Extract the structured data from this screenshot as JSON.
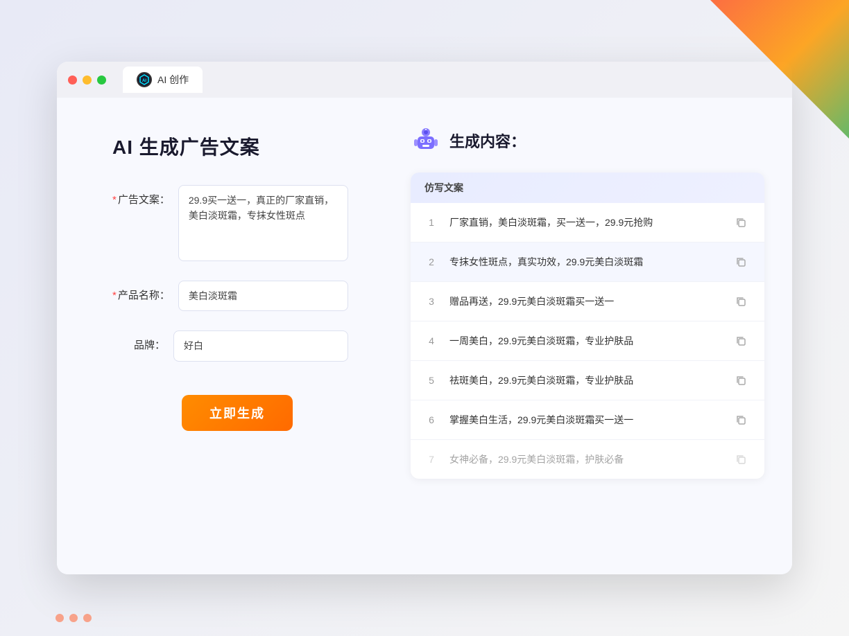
{
  "browser": {
    "tab_icon_label": "AI",
    "tab_title": "AI 创作"
  },
  "left_panel": {
    "page_title": "AI 生成广告文案",
    "form": {
      "ad_copy_label": "广告文案：",
      "ad_copy_required": "*",
      "ad_copy_value": "29.9买一送一，真正的厂家直销，美白淡斑霜，专抹女性斑点",
      "product_name_label": "产品名称：",
      "product_name_required": "*",
      "product_name_value": "美白淡斑霜",
      "brand_label": "品牌：",
      "brand_value": "好白"
    },
    "generate_button_label": "立即生成"
  },
  "right_panel": {
    "title": "生成内容：",
    "table_header": "仿写文案",
    "results": [
      {
        "id": 1,
        "text": "厂家直销，美白淡斑霜，买一送一，29.9元抢购"
      },
      {
        "id": 2,
        "text": "专抹女性斑点，真实功效，29.9元美白淡斑霜"
      },
      {
        "id": 3,
        "text": "赠品再送，29.9元美白淡斑霜买一送一"
      },
      {
        "id": 4,
        "text": "一周美白，29.9元美白淡斑霜，专业护肤品"
      },
      {
        "id": 5,
        "text": "祛斑美白，29.9元美白淡斑霜，专业护肤品"
      },
      {
        "id": 6,
        "text": "掌握美白生活，29.9元美白淡斑霜买一送一"
      },
      {
        "id": 7,
        "text": "女神必备，29.9元美白淡斑霜，护肤必备"
      }
    ]
  }
}
